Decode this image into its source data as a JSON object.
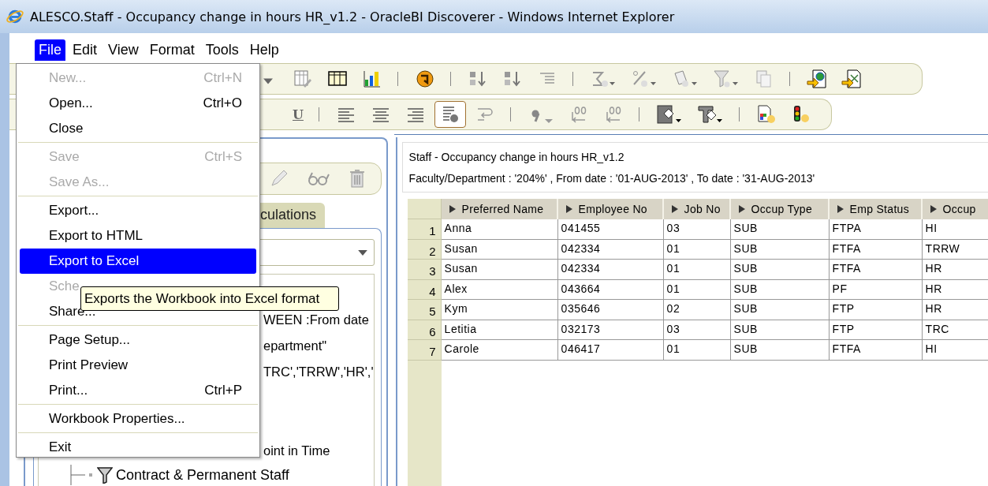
{
  "window": {
    "title": "ALESCO.Staff - Occupancy change in hours HR_v1.2 - OracleBI Discoverer - Windows Internet Explorer"
  },
  "menubar": [
    {
      "label": "File",
      "selected": true
    },
    {
      "label": "Edit",
      "selected": false
    },
    {
      "label": "View",
      "selected": false
    },
    {
      "label": "Format",
      "selected": false
    },
    {
      "label": "Tools",
      "selected": false
    },
    {
      "label": "Help",
      "selected": false
    }
  ],
  "toolbars": [
    {
      "items": [
        {
          "kind": "caret"
        },
        {
          "kind": "button",
          "pressed": false
        },
        {
          "kind": "button",
          "pressed": false
        },
        {
          "kind": "button",
          "pressed": false
        },
        {
          "kind": "separator"
        },
        {
          "kind": "button",
          "pressed": false
        },
        {
          "kind": "separator"
        },
        {
          "kind": "button",
          "pressed": false
        },
        {
          "kind": "button",
          "pressed": false
        },
        {
          "kind": "button",
          "pressed": false
        },
        {
          "kind": "separator"
        },
        {
          "kind": "button",
          "pressed": false
        },
        {
          "kind": "button",
          "pressed": false
        },
        {
          "kind": "button",
          "pressed": false
        },
        {
          "kind": "button",
          "pressed": false
        },
        {
          "kind": "button",
          "pressed": false
        },
        {
          "kind": "separator"
        },
        {
          "kind": "button",
          "pressed": false
        },
        {
          "kind": "button",
          "pressed": false
        }
      ]
    },
    {
      "items": [
        {
          "kind": "text-button",
          "label": "U",
          "pressed": false
        },
        {
          "kind": "separator"
        },
        {
          "kind": "button",
          "pressed": false
        },
        {
          "kind": "button",
          "pressed": false
        },
        {
          "kind": "button",
          "pressed": false
        },
        {
          "kind": "button",
          "pressed": true
        },
        {
          "kind": "button",
          "pressed": false
        },
        {
          "kind": "separator"
        },
        {
          "kind": "button",
          "pressed": false
        },
        {
          "kind": "button",
          "pressed": false
        },
        {
          "kind": "button",
          "pressed": false
        },
        {
          "kind": "separator"
        },
        {
          "kind": "button",
          "pressed": false
        },
        {
          "kind": "button",
          "pressed": false
        },
        {
          "kind": "separator"
        },
        {
          "kind": "button",
          "pressed": false
        },
        {
          "kind": "button",
          "pressed": false
        }
      ]
    }
  ],
  "file_menu": [
    {
      "kind": "item",
      "label": "New...",
      "shortcut": "Ctrl+N",
      "disabled": true,
      "selected": false
    },
    {
      "kind": "item",
      "label": "Open...",
      "shortcut": "Ctrl+O",
      "disabled": false,
      "selected": false
    },
    {
      "kind": "item",
      "label": "Close",
      "disabled": false,
      "selected": false
    },
    {
      "kind": "separator"
    },
    {
      "kind": "item",
      "label": "Save",
      "shortcut": "Ctrl+S",
      "disabled": true,
      "selected": false
    },
    {
      "kind": "item",
      "label": "Save As...",
      "disabled": true,
      "selected": false
    },
    {
      "kind": "separator"
    },
    {
      "kind": "item",
      "label": "Export...",
      "disabled": false,
      "selected": false
    },
    {
      "kind": "item",
      "label": "Export to HTML",
      "disabled": false,
      "selected": false
    },
    {
      "kind": "item",
      "label": "Export to Excel",
      "disabled": false,
      "selected": true
    },
    {
      "kind": "item",
      "label": "Sche",
      "disabled": true,
      "selected": false
    },
    {
      "kind": "item",
      "label": "Share...",
      "disabled": false,
      "selected": false
    },
    {
      "kind": "separator"
    },
    {
      "kind": "item",
      "label": "Page Setup...",
      "disabled": false,
      "selected": false
    },
    {
      "kind": "item",
      "label": "Print Preview",
      "disabled": false,
      "selected": false
    },
    {
      "kind": "item",
      "label": "Print...",
      "shortcut": "Ctrl+P",
      "disabled": false,
      "selected": false
    },
    {
      "kind": "separator"
    },
    {
      "kind": "item",
      "label": "Workbook Properties...",
      "disabled": false,
      "selected": false
    },
    {
      "kind": "separator"
    },
    {
      "kind": "item",
      "label": "Exit",
      "disabled": false,
      "selected": false
    }
  ],
  "tooltip": "Exports the Workbook into Excel format",
  "left_panel": {
    "tab": "culations",
    "tree_rows": [
      "WEEN :From date",
      "epartment\"",
      "TRC','TRRW','HR','"
    ],
    "tree_row_lower": "oint in Time",
    "tree_leaf": "Contract & Permanent Staff"
  },
  "report": {
    "title": "Staff - Occupancy change in hours HR_v1.2",
    "parameters": "Faculty/Department : '204%' , From date : '01-AUG-2013' , To date : '31-AUG-2013'",
    "columns": [
      "Preferred Name",
      "Employee No",
      "Job No",
      "Occup Type",
      "Emp Status",
      "Occup"
    ],
    "rows": [
      {
        "number": "1",
        "cells": [
          "Anna",
          "041455",
          "03",
          "SUB",
          "FTPA",
          "HI"
        ]
      },
      {
        "number": "2",
        "cells": [
          "Susan",
          "042334",
          "01",
          "SUB",
          "FTFA",
          "TRRW"
        ]
      },
      {
        "number": "3",
        "cells": [
          "Susan",
          "042334",
          "01",
          "SUB",
          "FTFA",
          "HR"
        ]
      },
      {
        "number": "4",
        "cells": [
          "Alex",
          "043664",
          "01",
          "SUB",
          "PF",
          "HR"
        ]
      },
      {
        "number": "5",
        "cells": [
          "Kym",
          "035646",
          "02",
          "SUB",
          "FTP",
          "HR"
        ]
      },
      {
        "number": "6",
        "cells": [
          "Letitia",
          "032173",
          "03",
          "SUB",
          "FTP",
          "TRC"
        ]
      },
      {
        "number": "7",
        "cells": [
          "Carole",
          "046417",
          "01",
          "SUB",
          "FTFA",
          "HI"
        ]
      }
    ]
  }
}
